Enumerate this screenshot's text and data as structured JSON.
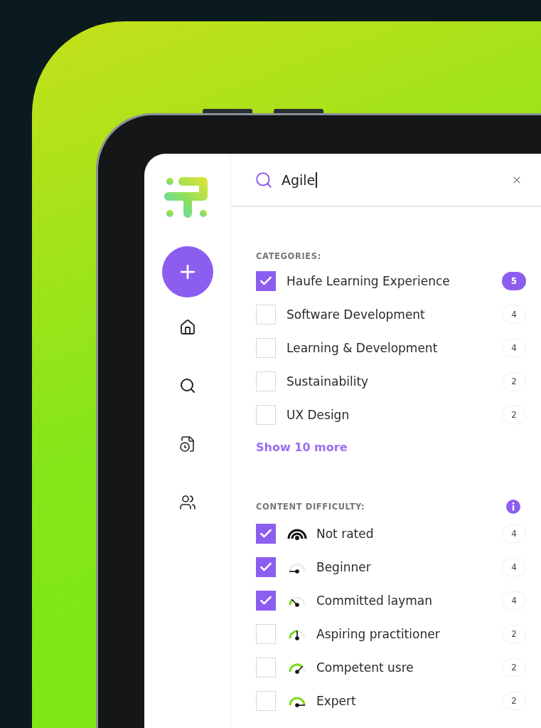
{
  "search": {
    "value": "Agile"
  },
  "categories": {
    "heading": "CATEGORIES:",
    "items": [
      {
        "label": "Haufe Learning Experience",
        "count": "5",
        "checked": true,
        "count_selected": true
      },
      {
        "label": "Software Development",
        "count": "4",
        "checked": false,
        "count_selected": false
      },
      {
        "label": "Learning & Development",
        "count": "4",
        "checked": false,
        "count_selected": false
      },
      {
        "label": "Sustainability",
        "count": "2",
        "checked": false,
        "count_selected": false
      },
      {
        "label": "UX Design",
        "count": "2",
        "checked": false,
        "count_selected": false
      }
    ],
    "more_link": "Show 10 more"
  },
  "difficulty": {
    "heading": "CONTENT DIFFICULTY:",
    "items": [
      {
        "label": "Not rated",
        "count": "4",
        "checked": true,
        "kind": "unrated"
      },
      {
        "label": "Beginner",
        "count": "4",
        "checked": true,
        "kind": "beginner"
      },
      {
        "label": "Committed layman",
        "count": "4",
        "checked": true,
        "kind": "layman"
      },
      {
        "label": "Aspiring practitioner",
        "count": "2",
        "checked": false,
        "kind": "practitioner"
      },
      {
        "label": "Competent usre",
        "count": "2",
        "checked": false,
        "kind": "competent"
      },
      {
        "label": "Expert",
        "count": "2",
        "checked": false,
        "kind": "expert"
      }
    ]
  }
}
